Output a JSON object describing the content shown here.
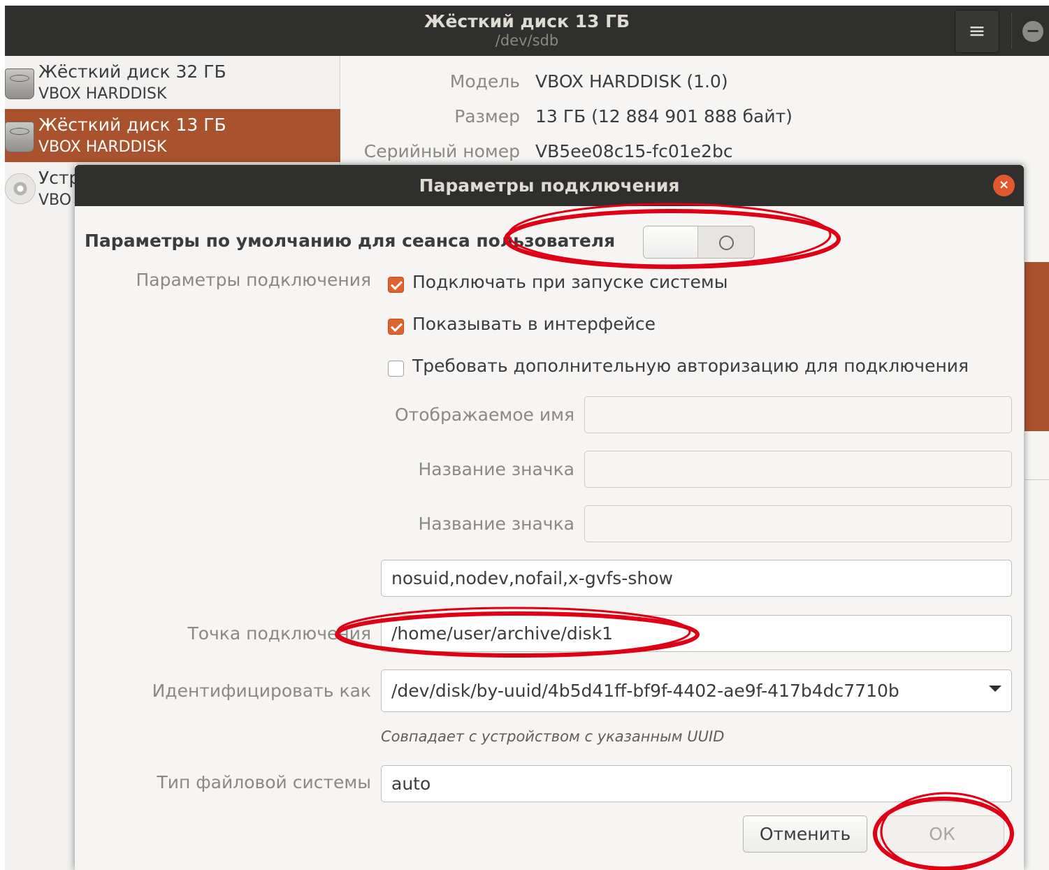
{
  "window": {
    "title": "Жёсткий диск 13 ГБ",
    "subtitle": "/dev/sdb",
    "menu_icon": "hamburger-menu-icon",
    "minimize_glyph": "−"
  },
  "sidebar": {
    "items": [
      {
        "name": "Жёсткий диск 32 ГБ",
        "model": "VBOX HARDDISK",
        "icon": "hard-disk-icon",
        "selected": false
      },
      {
        "name": "Жёсткий диск 13 ГБ",
        "model": "VBOX HARDDISK",
        "icon": "hard-disk-icon",
        "selected": true
      },
      {
        "name": "Устр",
        "model": "VBO",
        "icon": "optical-disc-icon",
        "selected": false
      }
    ]
  },
  "details": {
    "model_label": "Модель",
    "model_value": "VBOX HARDDISK (1.0)",
    "size_label": "Размер",
    "size_value": "13 ГБ (12 884 901 888 байт)",
    "serial_label": "Серийный номер",
    "serial_value": "VB5ee08c15-fc01e2bc"
  },
  "dialog": {
    "title": "Параметры подключения",
    "close_glyph": "×",
    "default_heading": "Параметры по умолчанию для сеанса пользователя",
    "default_toggle": "off",
    "mount_options_label": "Параметры подключения",
    "checks": [
      {
        "label": "Подключать при запуске системы",
        "checked": true
      },
      {
        "label": "Показывать в интерфейсе",
        "checked": true
      },
      {
        "label": "Требовать дополнительную авторизацию для подключения",
        "checked": false
      }
    ],
    "display_name_label": "Отображаемое имя",
    "display_name_value": "",
    "icon_name_label": "Название значка",
    "icon_name_value": "",
    "symbolic_icon_label": "Название значка",
    "symbolic_icon_value": "",
    "options_value": "nosuid,nodev,nofail,x-gvfs-show",
    "mount_point_label": "Точка подключения",
    "mount_point_value": "/home/user/archive/disk1",
    "identify_as_label": "Идентифицировать как",
    "identify_as_value": "/dev/disk/by-uuid/4b5d41ff-bf9f-4402-ae9f-417b4dc7710b",
    "identify_hint": "Совпадает с устройством с указанным UUID",
    "fs_type_label": "Тип файловой системы",
    "fs_type_value": "auto",
    "cancel_label": "Отменить",
    "ok_label": "ОК"
  },
  "colors": {
    "accent": "#a9522d",
    "checkbox": "#e0622d",
    "close_button": "#e2582d",
    "titlebar": "#2f2f2d",
    "annotation": "#e00016"
  }
}
